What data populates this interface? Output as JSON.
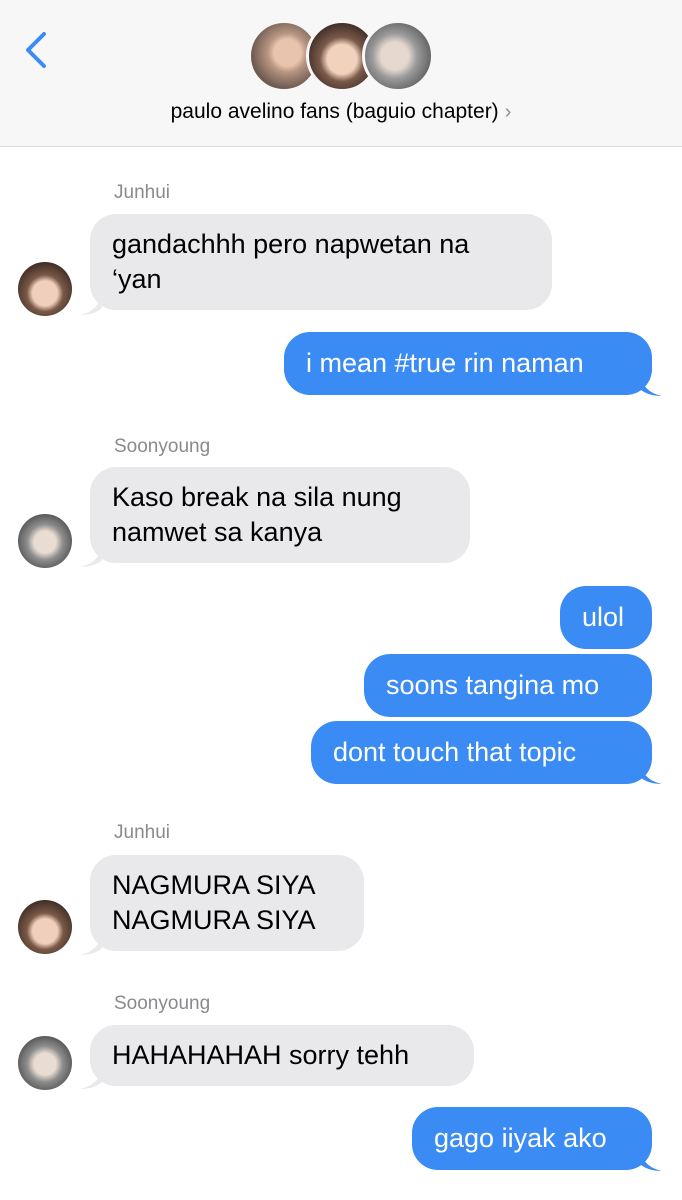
{
  "header": {
    "back_icon": "chevron-left-icon",
    "group_name": "paulo avelino fans (baguio chapter)",
    "chevron": "›"
  },
  "colors": {
    "incoming_bubble": "#e9e9eb",
    "outgoing_bubble": "#3a8bf3",
    "accent": "#3a8bf3",
    "sender_name": "#8a8a8e"
  },
  "messages": [
    {
      "direction": "in",
      "sender": "Junhui",
      "lines": [
        "gandachhh pero napwetan na",
        "‘yan"
      ]
    },
    {
      "direction": "out",
      "text": "i mean #true rin naman"
    },
    {
      "direction": "in",
      "sender": "Soonyoung",
      "lines": [
        "Kaso break na sila nung",
        "namwet sa kanya"
      ]
    },
    {
      "direction": "out",
      "text": "ulol"
    },
    {
      "direction": "out",
      "text": "soons tangina mo"
    },
    {
      "direction": "out",
      "text": "dont touch that topic"
    },
    {
      "direction": "in",
      "sender": "Junhui",
      "lines": [
        "NAGMURA SIYA",
        "NAGMURA SIYA"
      ]
    },
    {
      "direction": "in",
      "sender": "Soonyoung",
      "lines": [
        "HAHAHAHAH sorry tehh"
      ]
    },
    {
      "direction": "out",
      "text": "gago iiyak ako"
    }
  ]
}
